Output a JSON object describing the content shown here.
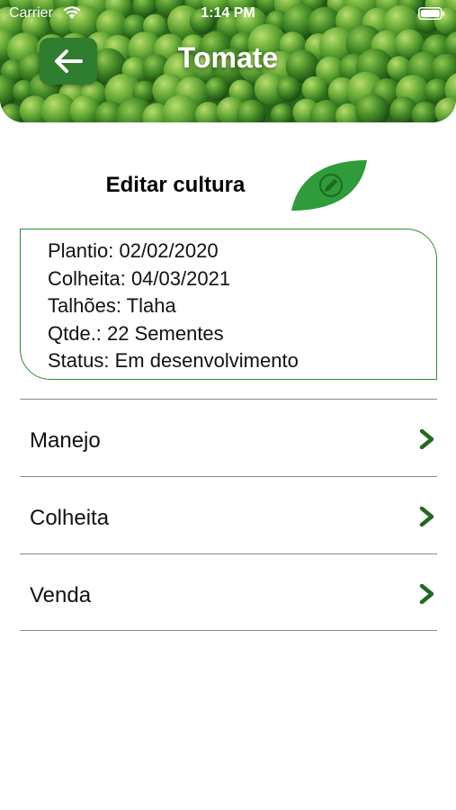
{
  "status_bar": {
    "carrier": "Carrier",
    "time": "1:14 PM"
  },
  "header": {
    "title": "Tomate",
    "background": "green-peas-photo",
    "back_icon": "arrow-left-icon"
  },
  "edit_section": {
    "title": "Editar cultura",
    "edit_icon": "pencil-leaf-icon"
  },
  "info_card": {
    "lines": [
      "Plantio: 02/02/2020",
      "Colheita: 04/03/2021",
      "Talhões: Tlaha",
      "Qtde.: 22 Sementes",
      "Status: Em desenvolvimento"
    ]
  },
  "menu": {
    "items": [
      {
        "label": "Manejo"
      },
      {
        "label": "Colheita"
      },
      {
        "label": "Venda"
      }
    ],
    "chevron_icon": "chevron-right-icon"
  },
  "colors": {
    "accent": "#2f7d2f",
    "card_border": "#2e8b2e",
    "divider": "#8a8a8a",
    "chevron": "#1f6b1f"
  }
}
